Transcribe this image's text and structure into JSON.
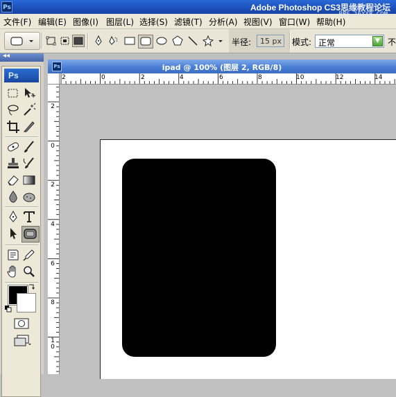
{
  "app": {
    "title": "Adobe Photoshop CS3",
    "title_overlay": "思缘教程论坛",
    "watermark": "BBS.16XX8.COM",
    "logo": "Ps"
  },
  "menu": [
    {
      "label": "文件(F)"
    },
    {
      "label": "编辑(E)"
    },
    {
      "label": "图像(I)"
    },
    {
      "label": "图层(L)"
    },
    {
      "label": "选择(S)"
    },
    {
      "label": "滤镜(T)"
    },
    {
      "label": "分析(A)"
    },
    {
      "label": "视图(V)"
    },
    {
      "label": "窗口(W)"
    },
    {
      "label": "帮助(H)"
    }
  ],
  "options": {
    "radius_label": "半径:",
    "radius_value": "15 px",
    "mode_label": "模式:",
    "mode_value": "正常",
    "trailing_label": "不"
  },
  "tools_panel": {
    "logo": "Ps",
    "collapse_arrows": "◂◂"
  },
  "document": {
    "title": "ipad @ 100% (图层 2, RGB/8)",
    "ruler_h": [
      "2",
      "0",
      "2",
      "4",
      "6",
      "8",
      "10",
      "12",
      "14"
    ],
    "ruler_v": [
      "2",
      "0",
      "2",
      "4",
      "6",
      "8",
      "1\n0"
    ]
  },
  "colors": {
    "foreground": "#000000",
    "background": "#ffffff",
    "shape_fill": "#000000"
  }
}
